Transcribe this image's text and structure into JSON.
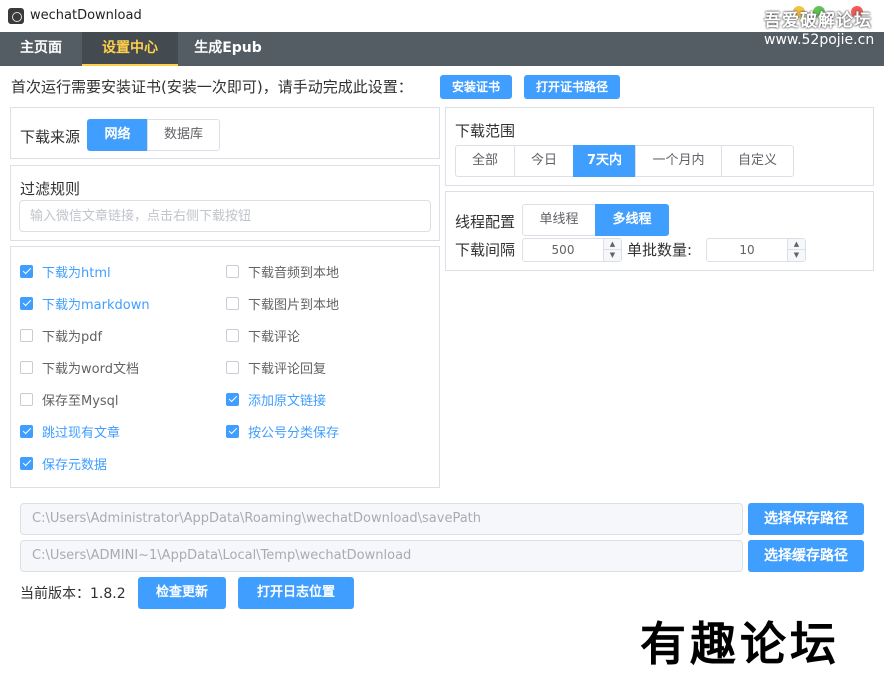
{
  "window": {
    "title": "wechatDownload"
  },
  "watermark": {
    "top_text": "吾爱破解论坛",
    "top_url": "www.52pojie.cn",
    "bottom_text": "有趣论坛"
  },
  "menu": {
    "items": [
      "主页面",
      "设置中心",
      "生成Epub"
    ],
    "active": "设置中心"
  },
  "cert": {
    "message": "首次运行需要安装证书(安装一次即可)，请手动完成此设置：",
    "install_label": "安装证书",
    "open_path_label": "打开证书路径"
  },
  "source": {
    "label": "下载来源",
    "options": [
      "网络",
      "数据库"
    ],
    "selected": "网络"
  },
  "range": {
    "label": "下载范围",
    "options": [
      "全部",
      "今日",
      "7天内",
      "一个月内",
      "自定义"
    ],
    "selected": "7天内"
  },
  "filter": {
    "label": "过滤规则",
    "placeholder": "输入微信文章链接，点击右侧下载按钮",
    "value": ""
  },
  "thread": {
    "label": "线程配置",
    "options": [
      "单线程",
      "多线程"
    ],
    "selected": "多线程",
    "interval_label": "下载间隔",
    "interval_value": "500",
    "batch_label": "单批数量:",
    "batch_value": "10"
  },
  "options": {
    "left": [
      {
        "label": "下载为html",
        "checked": true
      },
      {
        "label": "下载为markdown",
        "checked": true
      },
      {
        "label": "下载为pdf",
        "checked": false
      },
      {
        "label": "下载为word文档",
        "checked": false
      },
      {
        "label": "保存至Mysql",
        "checked": false
      },
      {
        "label": "跳过现有文章",
        "checked": true
      },
      {
        "label": "保存元数据",
        "checked": true
      }
    ],
    "right": [
      {
        "label": "下载音频到本地",
        "checked": false
      },
      {
        "label": "下载图片到本地",
        "checked": false
      },
      {
        "label": "下载评论",
        "checked": false
      },
      {
        "label": "下载评论回复",
        "checked": false
      },
      {
        "label": "添加原文链接",
        "checked": true
      },
      {
        "label": "按公号分类保存",
        "checked": true
      }
    ]
  },
  "paths": {
    "save_path": "C:\\Users\\Administrator\\AppData\\Roaming\\wechatDownload\\savePath",
    "save_button": "选择保存路径",
    "cache_path": "C:\\Users\\ADMINI~1\\AppData\\Local\\Temp\\wechatDownload",
    "cache_button": "选择缓存路径"
  },
  "version": {
    "label": "当前版本：",
    "value": "1.8.2",
    "check_update_label": "检查更新",
    "open_log_label": "打开日志位置"
  },
  "colors": {
    "primary": "#409eff",
    "menu_bg": "#545c64",
    "menu_active": "#ffd04b"
  }
}
